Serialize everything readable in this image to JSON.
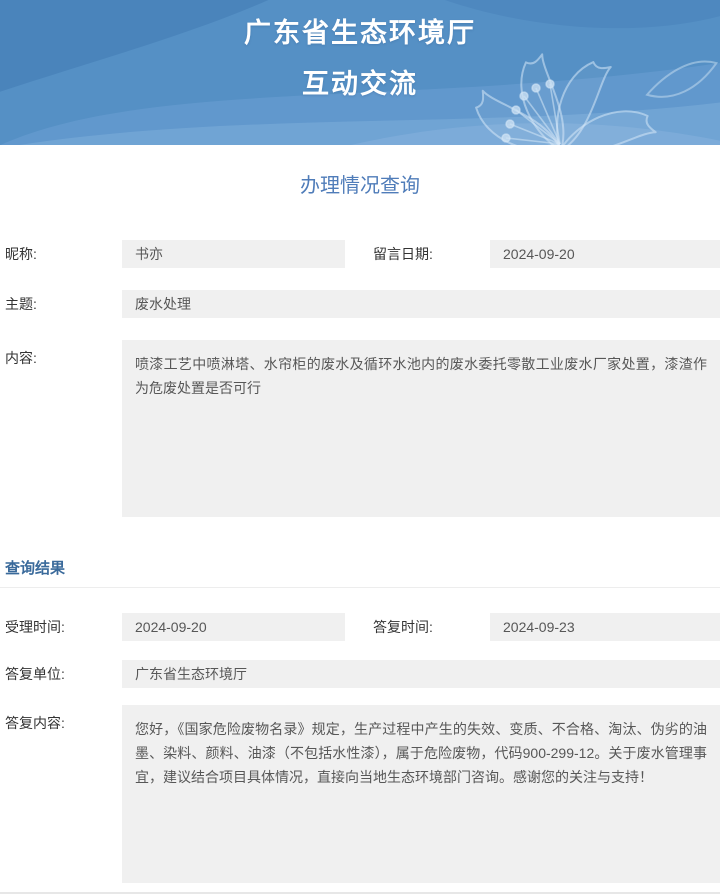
{
  "header": {
    "title_line1": "广东省生态环境厅",
    "title_line2": "互动交流"
  },
  "page": {
    "title": "办理情况查询"
  },
  "message": {
    "nickname_label": "昵称:",
    "nickname_value": "书亦",
    "date_label": "留言日期:",
    "date_value": "2024-09-20",
    "subject_label": "主题:",
    "subject_value": "废水处理",
    "content_label": "内容:",
    "content_value": "喷漆工艺中喷淋塔、水帘柜的废水及循环水池内的废水委托零散工业废水厂家处置，漆渣作为危废处置是否可行"
  },
  "result": {
    "section_title": "查询结果",
    "accept_time_label": "受理时间:",
    "accept_time_value": "2024-09-20",
    "reply_time_label": "答复时间:",
    "reply_time_value": "2024-09-23",
    "reply_unit_label": "答复单位:",
    "reply_unit_value": "广东省生态环境厅",
    "reply_content_label": "答复内容:",
    "reply_content_value": "您好，《国家危险废物名录》规定，生产过程中产生的失效、变质、不合格、淘汰、伪劣的油墨、染料、颜料、油漆（不包括水性漆），属于危险废物，代码900-299-12。关于废水管理事宜，建议结合项目具体情况，直接向当地生态环境部门咨询。感谢您的关注与支持！"
  },
  "colors": {
    "banner_base": "#5590c5",
    "banner_dark": "#4a84bb",
    "banner_light": "#6ba0d2",
    "banner_lighter": "#7dacd9",
    "page_title": "#4f7cb9",
    "section_title": "#3a6a9b",
    "field_background": "#f0f0f0"
  }
}
